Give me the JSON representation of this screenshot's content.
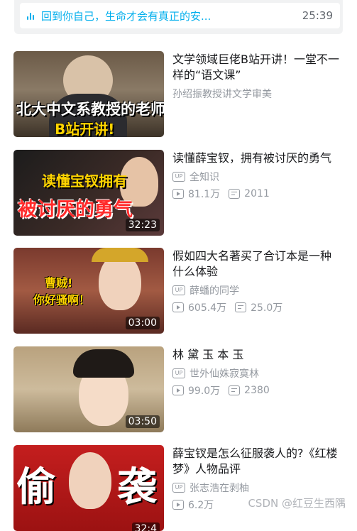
{
  "resume_bar": {
    "text": "回到你自己，生命才会有真正的安...",
    "time": "25:39"
  },
  "videos": [
    {
      "title": "文学领域巨佬B站开讲！一堂不一样的“语文课”",
      "subtitle": "孙绍振教授讲文学审美",
      "thumb_text": [
        "北大中文系教授的老师",
        "B站开讲!"
      ]
    },
    {
      "title": "读懂薛宝钗，拥有被讨厌的勇气",
      "author": "全知识",
      "views": "81.1万",
      "danmaku": "2011",
      "duration": "32:23",
      "thumb_text": [
        "读懂宝钗拥有",
        "被讨厌的勇气"
      ]
    },
    {
      "title": "假如四大名著买了合订本是一种什么体验",
      "author": "薛蟠的同学",
      "views": "605.4万",
      "danmaku": "25.0万",
      "duration": "03:00",
      "thumb_text": [
        "曹贼!",
        "你好骚啊！"
      ]
    },
    {
      "title": "林 黛 玉 本 玉",
      "author": "世外仙姝寂寞林",
      "views": "99.0万",
      "danmaku": "2380",
      "duration": "03:50"
    },
    {
      "title": "薛宝钗是怎么征服袭人的?《红楼梦》人物品评",
      "author": "张志浩在剥柚",
      "views": "6.2万",
      "duration": "32:4",
      "thumb_text": [
        "偷",
        "袭"
      ]
    }
  ],
  "watermark": "CSDN @红豆生西隅",
  "icons": {
    "up": "UP",
    "play": "play-count-icon",
    "danmaku": "danmaku-icon"
  }
}
